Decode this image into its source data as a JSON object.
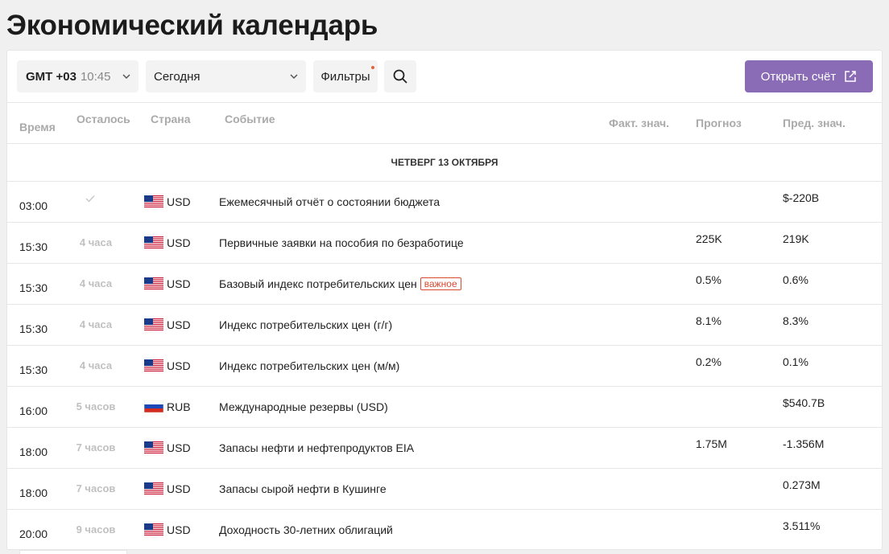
{
  "page": {
    "title": "Экономический календарь"
  },
  "toolbar": {
    "timezone": {
      "gmt": "GMT +03",
      "clock": "10:45"
    },
    "date_select": {
      "value": "Сегодня"
    },
    "filters_label": "Фильтры",
    "open_account_label": "Открыть счёт"
  },
  "table": {
    "headers": {
      "time": "Время",
      "remaining": "Осталось",
      "country": "Страна",
      "event": "Событие",
      "actual": "Факт. знач.",
      "forecast": "Прогноз",
      "previous": "Пред. знач."
    },
    "day_label": "ЧЕТВЕРГ 13 ОКТЯБРЯ",
    "important_label": "важное",
    "rows": [
      {
        "time": "03:00",
        "remaining": "",
        "done": true,
        "flag": "us-flag",
        "currency": "USD",
        "event": "Ежемесячный отчёт о состоянии бюджета",
        "important": false,
        "forecast": "",
        "previous": "$-220B"
      },
      {
        "time": "15:30",
        "remaining": "4 часа",
        "done": false,
        "flag": "us-flag",
        "currency": "USD",
        "event": "Первичные заявки на пособия по безработице",
        "important": false,
        "forecast": "225K",
        "previous": "219K"
      },
      {
        "time": "15:30",
        "remaining": "4 часа",
        "done": false,
        "flag": "us-flag",
        "currency": "USD",
        "event": "Базовый индекс потребительских цен",
        "important": true,
        "forecast": "0.5%",
        "previous": "0.6%"
      },
      {
        "time": "15:30",
        "remaining": "4 часа",
        "done": false,
        "flag": "us-flag",
        "currency": "USD",
        "event": "Индекс потребительских цен (г/г)",
        "important": false,
        "forecast": "8.1%",
        "previous": "8.3%"
      },
      {
        "time": "15:30",
        "remaining": "4 часа",
        "done": false,
        "flag": "us-flag",
        "currency": "USD",
        "event": "Индекс потребительских цен (м/м)",
        "important": false,
        "forecast": "0.2%",
        "previous": "0.1%"
      },
      {
        "time": "16:00",
        "remaining": "5 часов",
        "done": false,
        "flag": "ru-flag",
        "currency": "RUB",
        "event": "Международные резервы (USD)",
        "important": false,
        "forecast": "",
        "previous": "$540.7B"
      },
      {
        "time": "18:00",
        "remaining": "7 часов",
        "done": false,
        "flag": "us-flag",
        "currency": "USD",
        "event": "Запасы нефти и нефтепродуктов EIA",
        "important": false,
        "forecast": "1.75M",
        "previous": "-1.356M"
      },
      {
        "time": "18:00",
        "remaining": "7 часов",
        "done": false,
        "flag": "us-flag",
        "currency": "USD",
        "event": "Запасы сырой нефти в Кушинге",
        "important": false,
        "forecast": "",
        "previous": "0.273M"
      },
      {
        "time": "20:00",
        "remaining": "9 часов",
        "done": false,
        "flag": "us-flag",
        "currency": "USD",
        "event": "Доходность 30-летних облигаций",
        "important": false,
        "forecast": "",
        "previous": "3.511%"
      }
    ]
  },
  "colors": {
    "accent": "#8a6bb5",
    "important": "#d94a30",
    "filter_dot": "#e2643a"
  }
}
